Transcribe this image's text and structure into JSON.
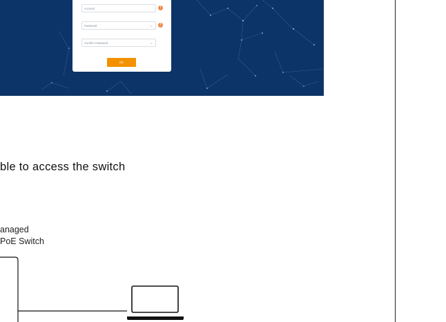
{
  "dialog": {
    "account_placeholder": "Account",
    "password_placeholder": "Password",
    "confirm_placeholder": "Confirm Password",
    "ok_label": "OK",
    "warn_glyph": "!",
    "eye_glyph": "ʻo,ʼ"
  },
  "heading": "ble to access the switch",
  "device": {
    "line1": "anaged",
    "line2": "PoE Switch"
  },
  "colors": {
    "banner": "#0d3468",
    "accent": "#f39100",
    "warning": "#f0894a"
  }
}
